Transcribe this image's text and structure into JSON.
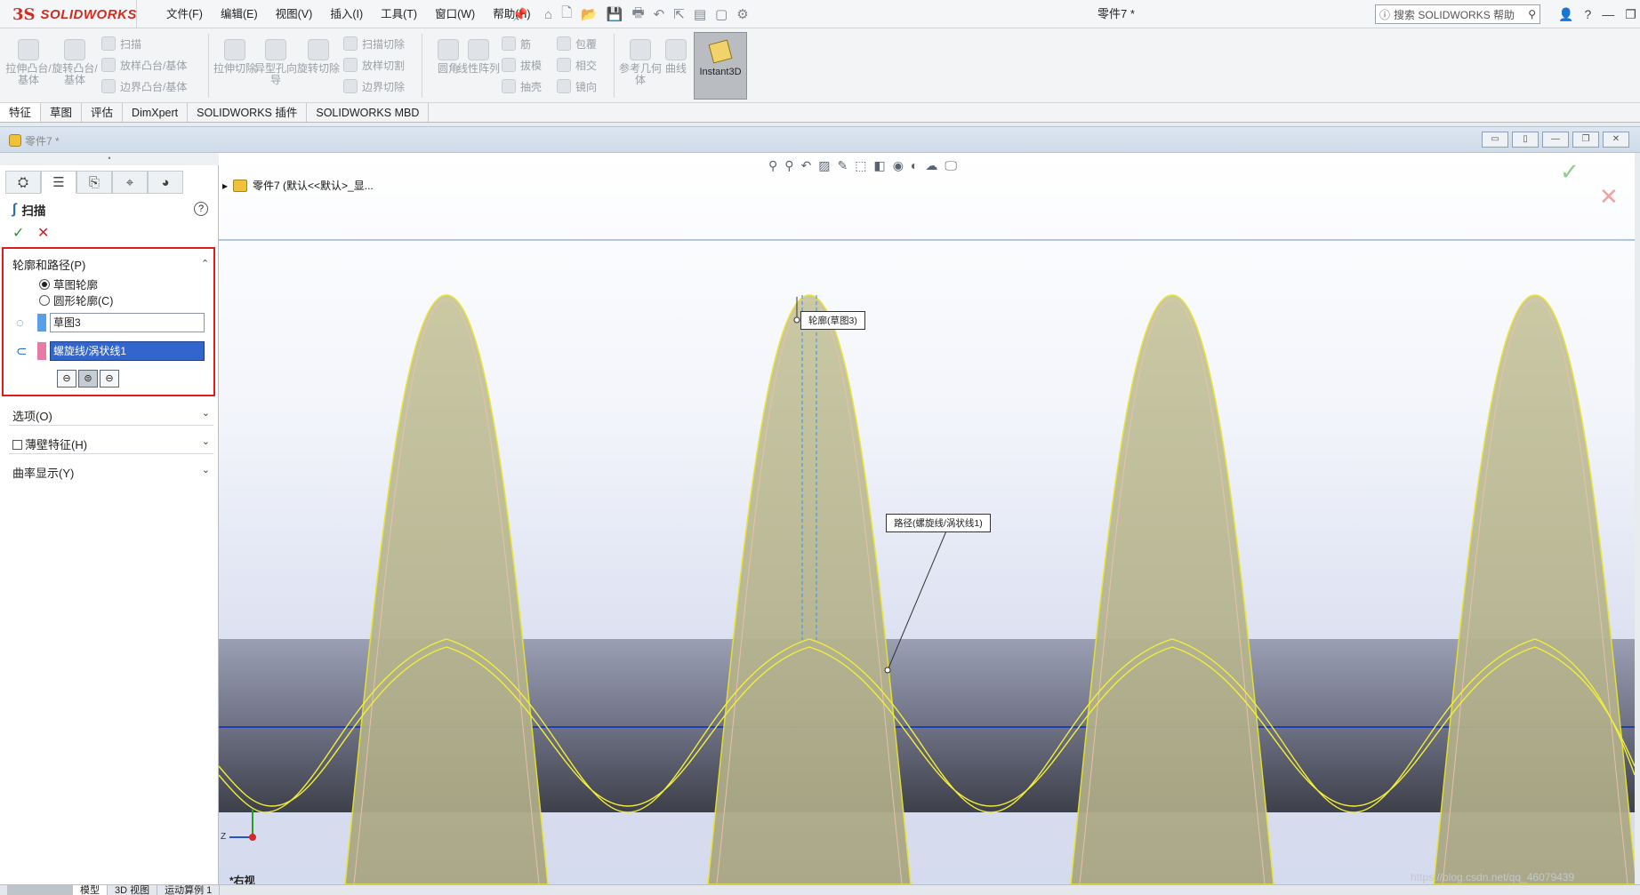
{
  "app": {
    "logo_ds": "3S",
    "logo_name": "SOLIDWORKS",
    "doc_title": "零件7 *",
    "search_placeholder": "搜索 SOLIDWORKS 帮助",
    "accent": "#d52b1e"
  },
  "menus": [
    "文件(F)",
    "编辑(E)",
    "视图(V)",
    "插入(I)",
    "工具(T)",
    "窗口(W)",
    "帮助(H)"
  ],
  "ribbon": {
    "extrude_boss": "拉伸凸台/基体",
    "revolve_boss": "旋转凸台/基体",
    "sweep": "扫描",
    "loft": "放样凸台/基体",
    "boundary": "边界凸台/基体",
    "extrude_cut": "拉伸切除",
    "hole_wizard": "异型孔向导",
    "revolve_cut": "旋转切除",
    "swept_cut": "扫描切除",
    "lofted_cut": "放样切割",
    "boundary_cut": "边界切除",
    "fillet": "圆角",
    "linear_pattern": "线性阵列",
    "rib": "筋",
    "draft": "拔模",
    "shell": "抽壳",
    "wrap": "包覆",
    "intersect": "相交",
    "mirror": "镜向",
    "ref_geometry": "参考几何体",
    "curves": "曲线",
    "instant3d": "Instant3D"
  },
  "tabs": [
    "特征",
    "草图",
    "评估",
    "DimXpert",
    "SOLIDWORKS 插件",
    "SOLIDWORKS MBD"
  ],
  "doc_window": {
    "title": "零件7 *"
  },
  "property_manager": {
    "title": "扫描",
    "group_title": "轮廓和路径(P)",
    "radio_sketch_profile": "草图轮廓",
    "radio_circular_profile": "圆形轮廓(C)",
    "profile_value": "草图3",
    "path_value": "螺旋线/涡状线1",
    "options": "选项(O)",
    "thin_feature": "薄壁特征(H)",
    "curvature_display": "曲率显示(Y)",
    "profile_color": "#5aa0e8",
    "path_color": "#e87aa8"
  },
  "viewport": {
    "tree_crumb": "零件7 (默认<<默认>_显...",
    "callout_profile": "轮廓(草图3)",
    "callout_path": "路径(螺旋线/涡状线1)",
    "view_name": "*右视",
    "watermark": "https://blog.csdn.net/qq_46079439",
    "axis_z": "Z"
  },
  "bottom_tabs": [
    "模型",
    "3D 视图",
    "运动算例 1"
  ]
}
